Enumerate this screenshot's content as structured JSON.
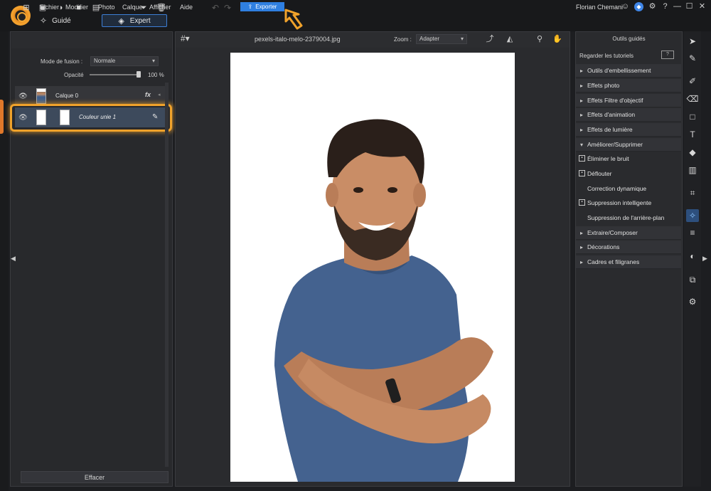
{
  "menu": {
    "items": [
      "Fichier",
      "Modifier",
      "Photo",
      "Calque",
      "Afficher",
      "Aide"
    ],
    "export_label": "Exporter"
  },
  "user": {
    "name": "Florian Chemani"
  },
  "modes": {
    "guided": "Guidé",
    "expert": "Expert"
  },
  "layers_panel": {
    "blend_label": "Mode de fusion :",
    "blend_value": "Normale",
    "opacity_label": "Opacité",
    "opacity_value": "100 %",
    "opacity_level": 1.0,
    "layers": [
      {
        "name": "Calque 0",
        "has_fx": true
      },
      {
        "name": "Couleur unie 1",
        "selected": true
      }
    ],
    "clear_label": "Effacer"
  },
  "canvas": {
    "filename": "pexels-italo-melo-2379004.jpg",
    "zoom_label": "Zoom :",
    "zoom_value": "Adapter"
  },
  "guided_tools": {
    "title": "Outils guidés",
    "tutorials": "Regarder les tutoriels",
    "categories_top": [
      "Outils d'embellissement",
      "Effets photo",
      "Effets Filtre d'objectif",
      "Effets d'animation",
      "Effets de lumière"
    ],
    "open_category": "Améliorer/Supprimer",
    "sub_items": [
      {
        "label": "Éliminer le bruit",
        "icon": true
      },
      {
        "label": "Déflouter",
        "icon": true
      },
      {
        "label": "Correction dynamique",
        "icon": false
      },
      {
        "label": "Suppression intelligente",
        "icon": true
      },
      {
        "label": "Suppression de l'arrière-plan",
        "icon": false
      }
    ],
    "categories_bottom": [
      "Extraire/Composer",
      "Décorations",
      "Cadres et filigranes"
    ]
  },
  "colors": {
    "accent": "#2f7fe0",
    "highlight": "#f0a22b",
    "panel": "#28292c"
  },
  "icons": {
    "help": "?",
    "minimize": "—",
    "maximize": "☐",
    "close": "✕"
  }
}
